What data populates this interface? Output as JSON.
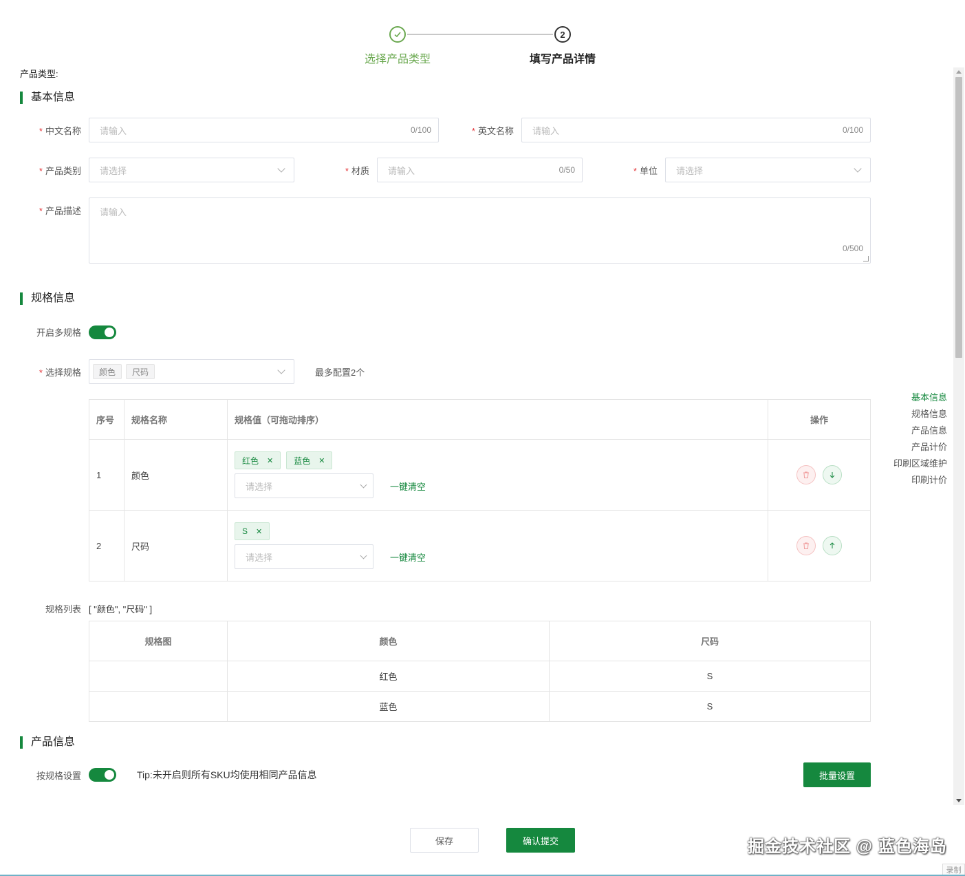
{
  "steps": [
    {
      "label": "选择产品类型",
      "icon": "check-icon",
      "status": "done"
    },
    {
      "label": "填写产品详情",
      "number": "2",
      "status": "current"
    }
  ],
  "product_type_label": "产品类型:",
  "basic": {
    "title": "基本信息",
    "cn_name": {
      "label": "中文名称",
      "placeholder": "请输入",
      "count": "0/100"
    },
    "en_name": {
      "label": "英文名称",
      "placeholder": "请输入",
      "count": "0/100"
    },
    "category": {
      "label": "产品类别",
      "placeholder": "请选择"
    },
    "material": {
      "label": "材质",
      "placeholder": "请输入",
      "count": "0/50"
    },
    "unit": {
      "label": "单位",
      "placeholder": "请选择"
    },
    "desc": {
      "label": "产品描述",
      "placeholder": "请输入",
      "count": "0/500"
    }
  },
  "spec": {
    "title": "规格信息",
    "multi_label": "开启多规格",
    "multi_enabled": true,
    "select_label": "选择规格",
    "selected": [
      "颜色",
      "尺码"
    ],
    "max_hint": "最多配置2个",
    "table_headers": [
      "序号",
      "规格名称",
      "规格值（可拖动排序）",
      "操作"
    ],
    "rows": [
      {
        "index": "1",
        "name": "颜色",
        "values": [
          "红色",
          "蓝色"
        ],
        "placeholder": "请选择",
        "clear": "一键清空",
        "move_icon": "arrow-down-icon"
      },
      {
        "index": "2",
        "name": "尺码",
        "values": [
          "S"
        ],
        "placeholder": "请选择",
        "clear": "一键清空",
        "move_icon": "arrow-up-icon"
      }
    ],
    "list_label": "规格列表",
    "list_value": "[ \"颜色\", \"尺码\" ]",
    "sku_headers": [
      "规格图",
      "颜色",
      "尺码"
    ],
    "sku_rows": [
      {
        "image": "",
        "color": "红色",
        "size": "S"
      },
      {
        "image": "",
        "color": "蓝色",
        "size": "S"
      }
    ]
  },
  "product_info": {
    "title": "产品信息",
    "by_spec_label": "按规格设置",
    "by_spec_enabled": true,
    "tip": "Tip:未开启则所有SKU均使用相同产品信息",
    "batch_button": "批量设置"
  },
  "anchor_nav": [
    "基本信息",
    "规格信息",
    "产品信息",
    "产品计价",
    "印刷区域维护",
    "印刷计价"
  ],
  "footer": {
    "save": "保存",
    "submit": "确认提交"
  },
  "watermark": "掘金技术社区 @ 蓝色海岛",
  "record_label": "录制",
  "colors": {
    "primary": "#15883e",
    "step_done": "#6aa84f",
    "required": "#e4393c"
  }
}
